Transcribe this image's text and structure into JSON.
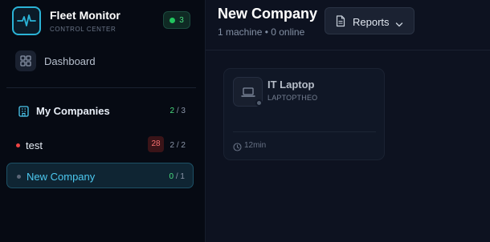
{
  "brand": {
    "name": "Fleet Monitor",
    "subtitle": "CONTROL CENTER",
    "online_count": "3",
    "accent": "#2bb3d6"
  },
  "nav": {
    "dashboard_label": "Dashboard"
  },
  "companies": {
    "heading": "My Companies",
    "online": "2",
    "total": "/ 3",
    "items": [
      {
        "name": "test",
        "alert_count": "28",
        "online": "2",
        "total": "/ 2",
        "status_color": "#ef4444"
      },
      {
        "name": "New Company",
        "online": "0",
        "total": "/ 1",
        "status_color": "#5b6677",
        "selected": true
      }
    ]
  },
  "header": {
    "title": "New Company",
    "subtitle": "1 machine • 0 online",
    "reports_label": "Reports"
  },
  "machines": [
    {
      "name": "IT Laptop",
      "hostname": "LAPTOPTHEO",
      "last_seen": "12min",
      "status": "offline"
    }
  ],
  "icons": {
    "logo": "pulse-icon",
    "dashboard": "grid-icon",
    "companies": "building-icon",
    "reports": "document-icon",
    "dropdown": "chevron-down-icon",
    "machine": "laptop-icon",
    "time": "clock-icon"
  }
}
